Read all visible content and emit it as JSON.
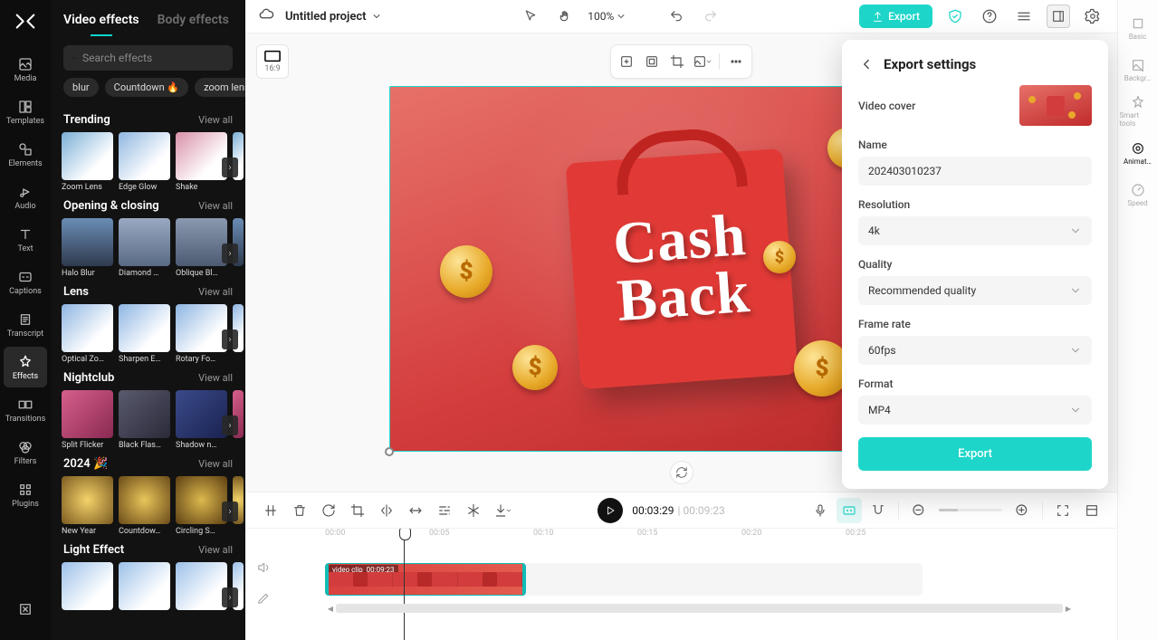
{
  "project": {
    "name": "Untitled project"
  },
  "topbar": {
    "zoom": "100%"
  },
  "exportBtn": "Export",
  "iconrail": [
    {
      "key": "media",
      "label": "Media"
    },
    {
      "key": "templates",
      "label": "Templates"
    },
    {
      "key": "elements",
      "label": "Elements"
    },
    {
      "key": "audio",
      "label": "Audio"
    },
    {
      "key": "text",
      "label": "Text"
    },
    {
      "key": "captions",
      "label": "Captions"
    },
    {
      "key": "transcript",
      "label": "Transcript"
    },
    {
      "key": "effects",
      "label": "Effects"
    },
    {
      "key": "transitions",
      "label": "Transitions"
    },
    {
      "key": "filters",
      "label": "Filters"
    },
    {
      "key": "plugins",
      "label": "Plugins"
    }
  ],
  "panel": {
    "tabs": [
      "Video effects",
      "Body effects"
    ],
    "search_placeholder": "Search effects",
    "chips": [
      "blur",
      "Countdown 🔥",
      "zoom lens"
    ],
    "view_all": "View all",
    "sections": [
      {
        "title": "Trending",
        "items": [
          "Zoom Lens",
          "Edge Glow",
          "Shake"
        ]
      },
      {
        "title": "Opening & closing",
        "items": [
          "Halo Blur",
          "Diamond …",
          "Oblique Bl…"
        ]
      },
      {
        "title": "Lens",
        "items": [
          "Optical Zo…",
          "Sharpen E…",
          "Rotary Fo…"
        ]
      },
      {
        "title": "Nightclub",
        "items": [
          "Split Flicker",
          "Black Flas…",
          "Shadow n…"
        ]
      },
      {
        "title": "2024 🎉",
        "items": [
          "New Year",
          "Countdow…",
          "Circling S…"
        ]
      },
      {
        "title": "Light Effect",
        "items": [
          "",
          "",
          ""
        ]
      }
    ]
  },
  "canvas": {
    "ratio": "16:9",
    "preview_text": "Cash\nBack"
  },
  "timeline": {
    "current": "00:03:29",
    "duration": "00:09:23",
    "marks": [
      "00:00",
      "00:05",
      "00:10",
      "00:15",
      "00:20",
      "00:25"
    ],
    "clip_label": "video clip",
    "clip_time": "00:09:23"
  },
  "righttabs": [
    {
      "key": "basic",
      "label": "Basic"
    },
    {
      "key": "backgr",
      "label": "Backgr…"
    },
    {
      "key": "smart",
      "label": "Smart tools"
    },
    {
      "key": "animat",
      "label": "Animat…"
    },
    {
      "key": "speed",
      "label": "Speed"
    }
  ],
  "export": {
    "title": "Export settings",
    "cover_label": "Video cover",
    "name_label": "Name",
    "name_value": "202403010237",
    "resolution_label": "Resolution",
    "resolution_value": "4k",
    "quality_label": "Quality",
    "quality_value": "Recommended quality",
    "framerate_label": "Frame rate",
    "framerate_value": "60fps",
    "format_label": "Format",
    "format_value": "MP4",
    "action": "Export"
  }
}
